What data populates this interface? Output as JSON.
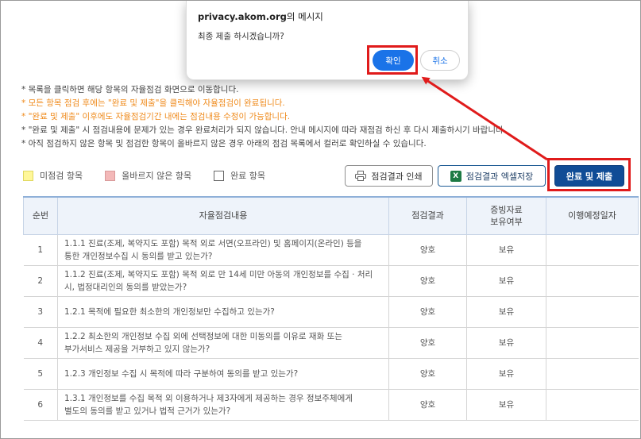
{
  "dialog": {
    "host": "privacy.akom.org",
    "title_suffix": "의 메시지",
    "message": "최종 제출 하시겠습니까?",
    "ok_label": "확인",
    "cancel_label": "취소"
  },
  "notes": [
    "* 목록을 클릭하면 해당 항목의 자율점검 화면으로 이동합니다.",
    "* 모든 항목 점검 후에는 \"완료 및 제출\"을 클릭해야 자율점검이 완료됩니다.",
    "* \"완료 및 제출\" 이후에도 자율점검기간 내에는 점검내용 수정이 가능합니다.",
    "* \"완료 및 제출\" 시 점검내용에 문제가 있는 경우 완료처리가 되지 않습니다. 안내 메시지에 따라 재점검 하신 후 다시 제출하시기 바랍니다.",
    "* 아직 점검하지 않은 항목 및 점검한 항목이 올바르지 않은 경우 아래의 점검 목록에서 컬러로 확인하실 수 있습니다."
  ],
  "legend": {
    "unchecked": "미점검 항목",
    "incorrect": "올바르지 않은 항목",
    "complete": "완료 항목"
  },
  "buttons": {
    "print": "점검결과 인쇄",
    "excel": "점검결과 엑셀저장",
    "excel_icon_text": "X",
    "submit": "완료 및 제출"
  },
  "colors": {
    "unchecked": "#fff799",
    "incorrect": "#f3b8b8",
    "submit_bg": "#104c96",
    "highlight": "#e01b1b"
  },
  "table": {
    "headers": {
      "no": "순번",
      "content": "자율점검내용",
      "result": "점검결과",
      "evidence_line1": "증빙자료",
      "evidence_line2": "보유여부",
      "plan": "이행예정일자"
    },
    "rows": [
      {
        "no": "1",
        "line1": "1.1.1 진료(조제, 복약지도 포함) 목적 외로 서면(오프라인) 및 홈페이지(온라인) 등을",
        "line2": "통한 개인정보수집 시 동의를 받고 있는가?",
        "result": "양호",
        "evidence": "보유",
        "plan": ""
      },
      {
        "no": "2",
        "line1": "1.1.2 진료(조제, 복약지도 포함) 목적 외로 만 14세 미만 아동의 개인정보를 수집 · 처리",
        "line2": "시, 법정대리인의 동의를 받았는가?",
        "result": "양호",
        "evidence": "보유",
        "plan": ""
      },
      {
        "no": "3",
        "line1": "1.2.1 목적에 필요한 최소한의 개인정보만 수집하고 있는가?",
        "line2": "",
        "result": "양호",
        "evidence": "보유",
        "plan": ""
      },
      {
        "no": "4",
        "line1": "1.2.2 최소한의 개인정보 수집 외에 선택정보에 대한 미동의를 이유로 재화 또는",
        "line2": "부가서비스 제공을 거부하고 있지 않는가?",
        "result": "양호",
        "evidence": "보유",
        "plan": ""
      },
      {
        "no": "5",
        "line1": "1.2.3 개인정보 수집 시 목적에 따라 구분하여 동의를 받고 있는가?",
        "line2": "",
        "result": "양호",
        "evidence": "보유",
        "plan": ""
      },
      {
        "no": "6",
        "line1": "1.3.1 개인정보를 수집 목적 외 이용하거나 제3자에게 제공하는 경우 정보주체에게",
        "line2": "별도의 동의를 받고 있거나 법적 근거가 있는가?",
        "result": "양호",
        "evidence": "보유",
        "plan": ""
      }
    ]
  }
}
